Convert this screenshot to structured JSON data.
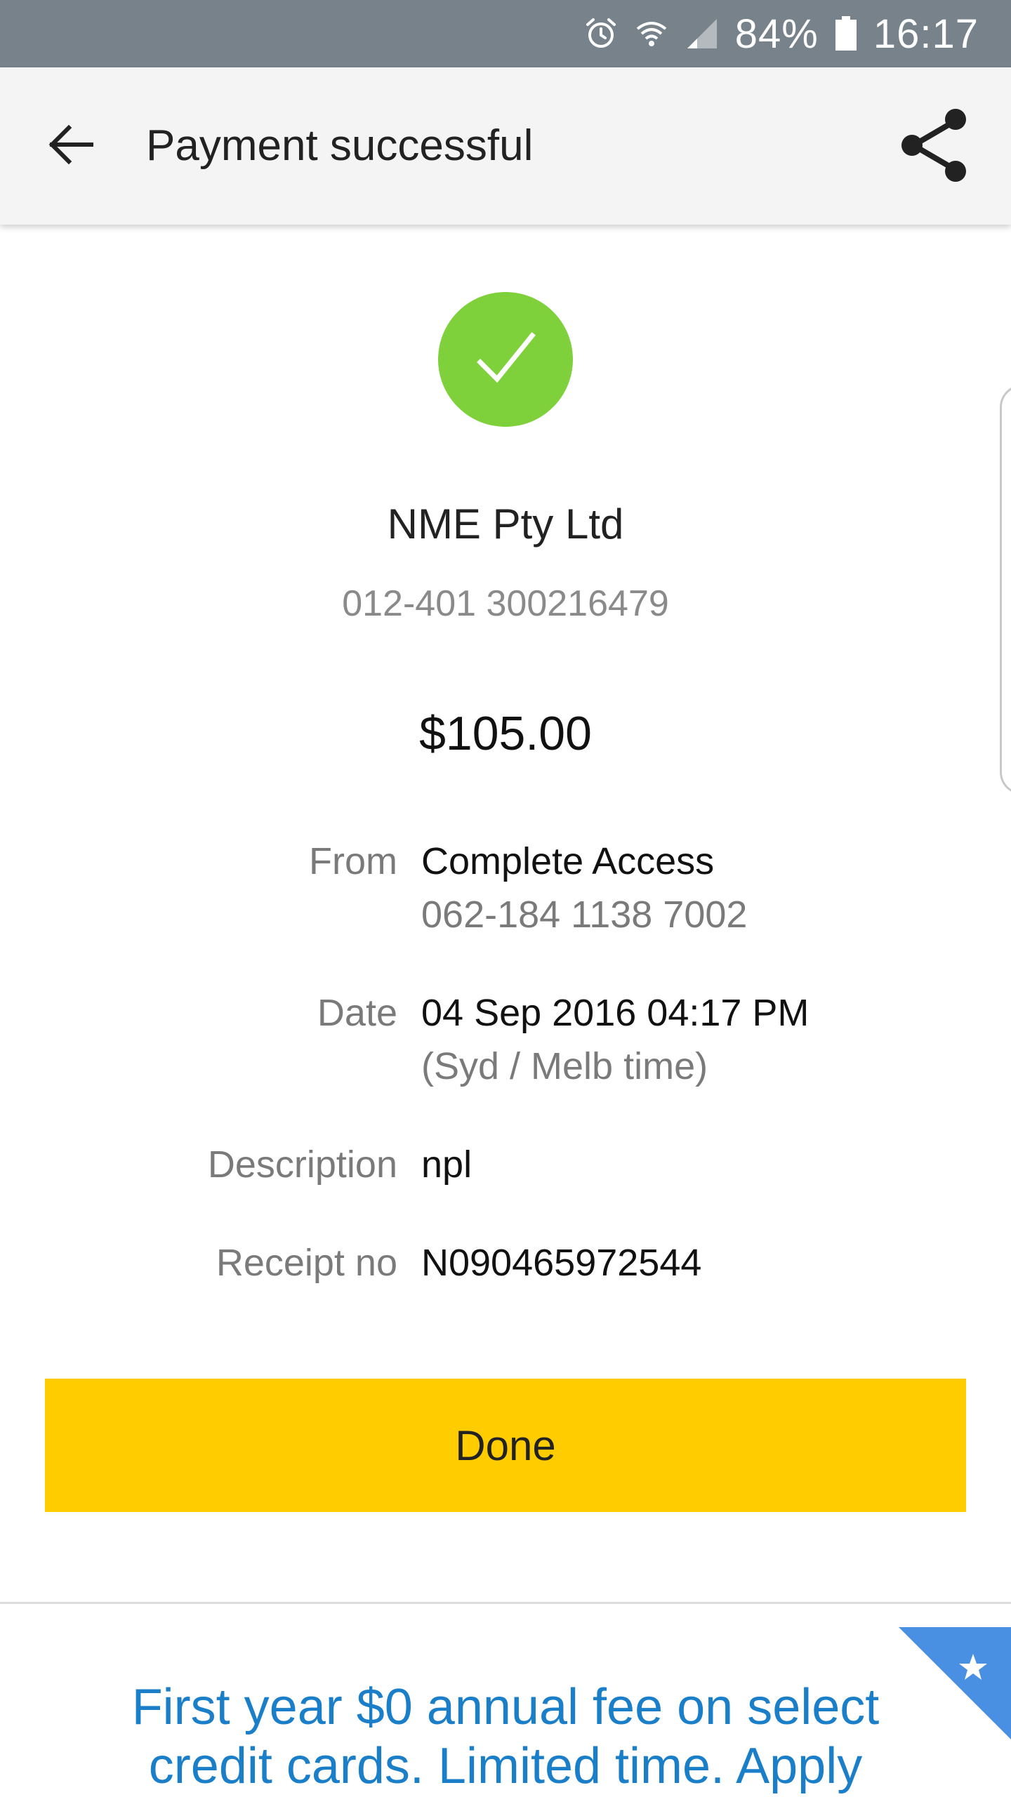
{
  "status_bar": {
    "battery": "84%",
    "time": "16:17",
    "icons": [
      "alarm-icon",
      "wifi-icon",
      "signal-icon",
      "battery-icon"
    ]
  },
  "app_bar": {
    "title": "Payment successful",
    "back_icon": "arrow-back-icon",
    "share_icon": "share-icon"
  },
  "payment": {
    "status_icon": "checkmark-icon",
    "payee_name": "NME Pty Ltd",
    "payee_account": "012-401 300216479",
    "amount": "$105.00"
  },
  "details": {
    "from": {
      "label": "From",
      "value": "Complete Access",
      "sub": "062-184 1138 7002"
    },
    "date": {
      "label": "Date",
      "value": "04 Sep 2016 04:17 PM",
      "sub": "(Syd / Melb time)"
    },
    "description": {
      "label": "Description",
      "value": "npl"
    },
    "receipt": {
      "label": "Receipt no",
      "value": "N090465972544"
    }
  },
  "actions": {
    "done_label": "Done"
  },
  "promo": {
    "text": "First year $0 annual fee on select credit cards. Limited time. Apply",
    "badge_icon": "star-icon"
  },
  "colors": {
    "status_bar": "#78828a",
    "app_bar": "#f4f4f4",
    "success_green": "#7ed13a",
    "done_yellow": "#ffcc00",
    "promo_blue": "#1a7fc8",
    "badge_blue": "#4a90e2"
  }
}
